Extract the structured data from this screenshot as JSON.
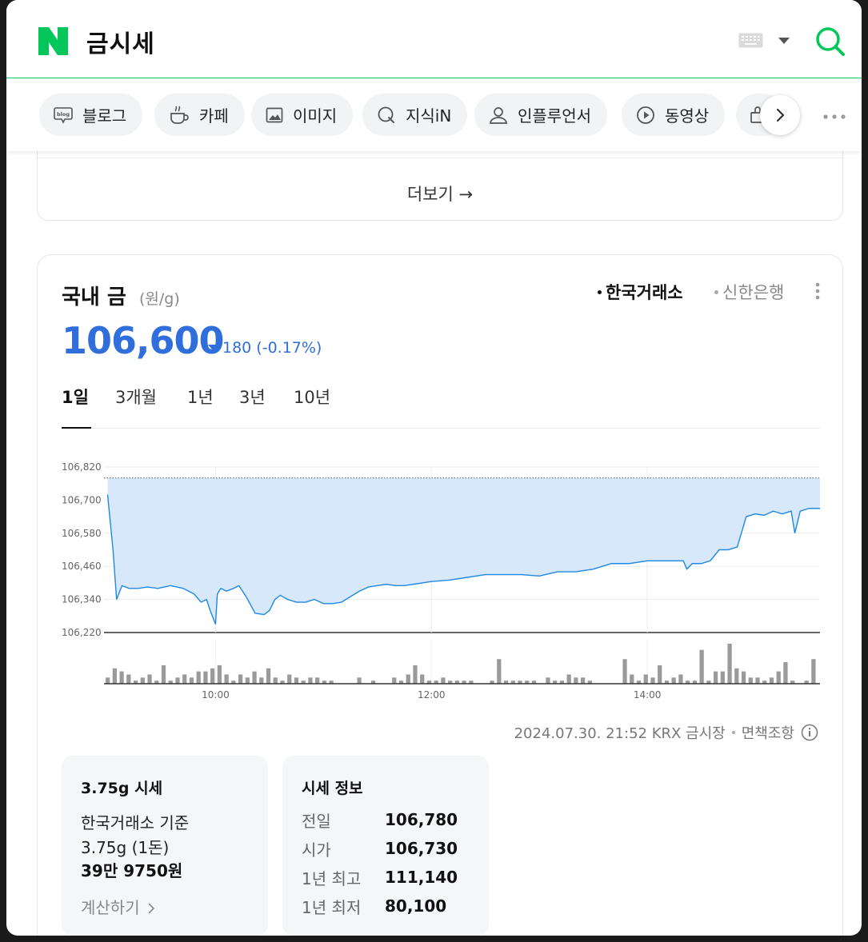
{
  "header": {
    "query": "금시세",
    "logo_letter": "N",
    "brand_color": "#03c75a"
  },
  "tabs": [
    {
      "label": "블로그",
      "icon": "blog-icon"
    },
    {
      "label": "카페",
      "icon": "cafe-cup-icon"
    },
    {
      "label": "이미지",
      "icon": "image-icon"
    },
    {
      "label": "지식iN",
      "icon": "knowledge-icon"
    },
    {
      "label": "인플루언서",
      "icon": "person-icon"
    },
    {
      "label": "동영상",
      "icon": "play-icon"
    }
  ],
  "more": {
    "label": "더보기 →"
  },
  "card": {
    "title": "국내 금",
    "unit": "(원/g)",
    "sources": [
      "한국거래소",
      "신한은행"
    ],
    "active_source": "한국거래소",
    "price": "106,600",
    "change": "180 (-0.17%)",
    "change_direction": "down",
    "price_color": "#2f6edb",
    "periods": [
      "1일",
      "3개월",
      "1년",
      "3년",
      "10년"
    ],
    "active_period": "1일",
    "timestamp": "2024.07.30. 21:52 KRX 금시장",
    "disclaimer": "면책조항"
  },
  "chart_data": {
    "type": "area",
    "y_ticks": [
      "106,820",
      "106,700",
      "106,580",
      "106,460",
      "106,340",
      "106,220"
    ],
    "ylim": [
      106220,
      106820
    ],
    "x_ticks": [
      "10:00",
      "12:00",
      "14:00"
    ],
    "xlim": [
      "08:58",
      "15:36"
    ],
    "reference_line": 106780,
    "series": [
      {
        "x": [
          "09:00",
          "09:03",
          "09:05",
          "09:08",
          "09:12",
          "09:17",
          "09:22",
          "09:28",
          "09:35",
          "09:42",
          "09:48",
          "09:52",
          "09:55",
          "09:57",
          "10:00",
          "10:01",
          "10:03",
          "10:06",
          "10:10",
          "10:13",
          "10:17",
          "10:22",
          "10:27",
          "10:30",
          "10:33",
          "10:36",
          "10:40",
          "10:45",
          "10:50",
          "10:55",
          "11:00",
          "11:05",
          "11:10",
          "11:15",
          "11:20",
          "11:25",
          "11:30",
          "11:35",
          "11:40",
          "11:45",
          "11:50",
          "11:55",
          "12:00",
          "12:10",
          "12:20",
          "12:30",
          "12:40",
          "12:50",
          "13:00",
          "13:10",
          "13:20",
          "13:30",
          "13:40",
          "13:50",
          "14:00",
          "14:10",
          "14:20",
          "14:22",
          "14:25",
          "14:30",
          "14:35",
          "14:40",
          "14:45",
          "14:50",
          "14:55",
          "15:00",
          "15:05",
          "15:10",
          "15:15",
          "15:20",
          "15:22",
          "15:25",
          "15:30",
          "15:35"
        ],
        "values": [
          106720,
          106520,
          106340,
          106390,
          106380,
          106380,
          106385,
          106380,
          106390,
          106380,
          106360,
          106330,
          106340,
          106300,
          106250,
          106360,
          106380,
          106370,
          106380,
          106390,
          106350,
          106290,
          106285,
          106300,
          106340,
          106355,
          106340,
          106330,
          106330,
          106340,
          106325,
          106325,
          106330,
          106350,
          106370,
          106385,
          106390,
          106395,
          106390,
          106390,
          106395,
          106400,
          106405,
          106410,
          106420,
          106430,
          106430,
          106430,
          106425,
          106440,
          106440,
          106450,
          106470,
          106470,
          106480,
          106480,
          106480,
          106450,
          106470,
          106470,
          106480,
          106520,
          106520,
          106530,
          106640,
          106650,
          106645,
          106660,
          106650,
          106660,
          106580,
          106660,
          106670,
          106670
        ]
      }
    ],
    "volume": {
      "values": [
        2,
        5,
        4,
        3,
        1,
        2,
        3,
        1,
        6,
        1,
        2,
        3,
        2,
        4,
        4,
        5,
        6,
        3,
        1,
        3,
        2,
        4,
        2,
        5,
        2,
        1,
        3,
        2,
        1,
        2,
        2,
        1,
        1,
        0,
        0,
        0,
        2,
        0,
        1,
        0,
        0,
        2,
        1,
        3,
        6,
        3,
        1,
        1,
        2,
        1,
        1,
        1,
        1,
        0,
        0,
        1,
        8,
        1,
        1,
        1,
        1,
        1,
        0,
        2,
        1,
        1,
        3,
        2,
        2,
        1,
        0,
        0,
        0,
        0,
        8,
        3,
        1,
        3,
        2,
        6,
        1,
        2,
        3,
        1,
        1,
        11,
        1,
        4,
        4,
        13,
        5,
        4,
        2,
        2,
        1,
        2,
        4,
        7,
        1,
        0,
        1,
        8
      ]
    },
    "fill_color": "#d6e8fa",
    "line_color": "#1f88e5",
    "grid": true
  },
  "box_a": {
    "title": "3.75g 시세",
    "line1": "한국거래소 기준",
    "line2": "3.75g (1돈)",
    "line3": "39만 9750원",
    "link": "계산하기"
  },
  "box_b": {
    "title": "시세 정보",
    "rows": [
      {
        "label": "전일",
        "value": "106,780"
      },
      {
        "label": "시가",
        "value": "106,730"
      },
      {
        "label": "1년 최고",
        "value": "111,140"
      },
      {
        "label": "1년 최저",
        "value": "80,100"
      }
    ]
  }
}
